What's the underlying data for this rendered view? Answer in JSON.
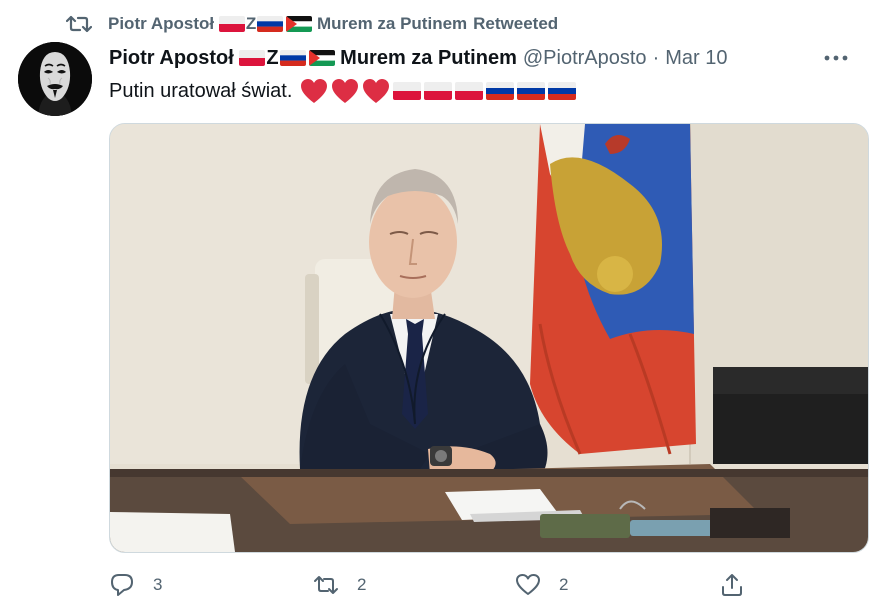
{
  "retweet_header": {
    "retweeter_name": "Piotr Apostoł",
    "retweeter_name_suffix": "Murem za Putinem",
    "retweeted_label": "Retweeted",
    "z_letter": "Z"
  },
  "tweet": {
    "display_name": "Piotr Apostoł",
    "display_name_suffix": "Murem za Putinem",
    "z_letter": "Z",
    "handle": "@PiotrAposto",
    "separator": "·",
    "date": "Mar 10",
    "text": "Putin uratował świat.",
    "emoji_sequence": [
      "red-heart",
      "red-heart",
      "red-heart",
      "poland-flag",
      "poland-flag",
      "poland-flag",
      "russia-flag",
      "russia-flag",
      "russia-flag"
    ],
    "name_emoji": [
      "poland-flag",
      "z-letter",
      "russia-flag",
      "palestine-flag"
    ]
  },
  "media": {
    "icon": "photo-of-man-seated-at-desk-with-flag"
  },
  "actions": {
    "reply_count": "3",
    "retweet_count": "2",
    "like_count": "2"
  },
  "colors": {
    "secondary_text": "#536471",
    "primary_text": "#0f1419",
    "heart_red": "#dd2e44",
    "border": "#cfd9de"
  }
}
